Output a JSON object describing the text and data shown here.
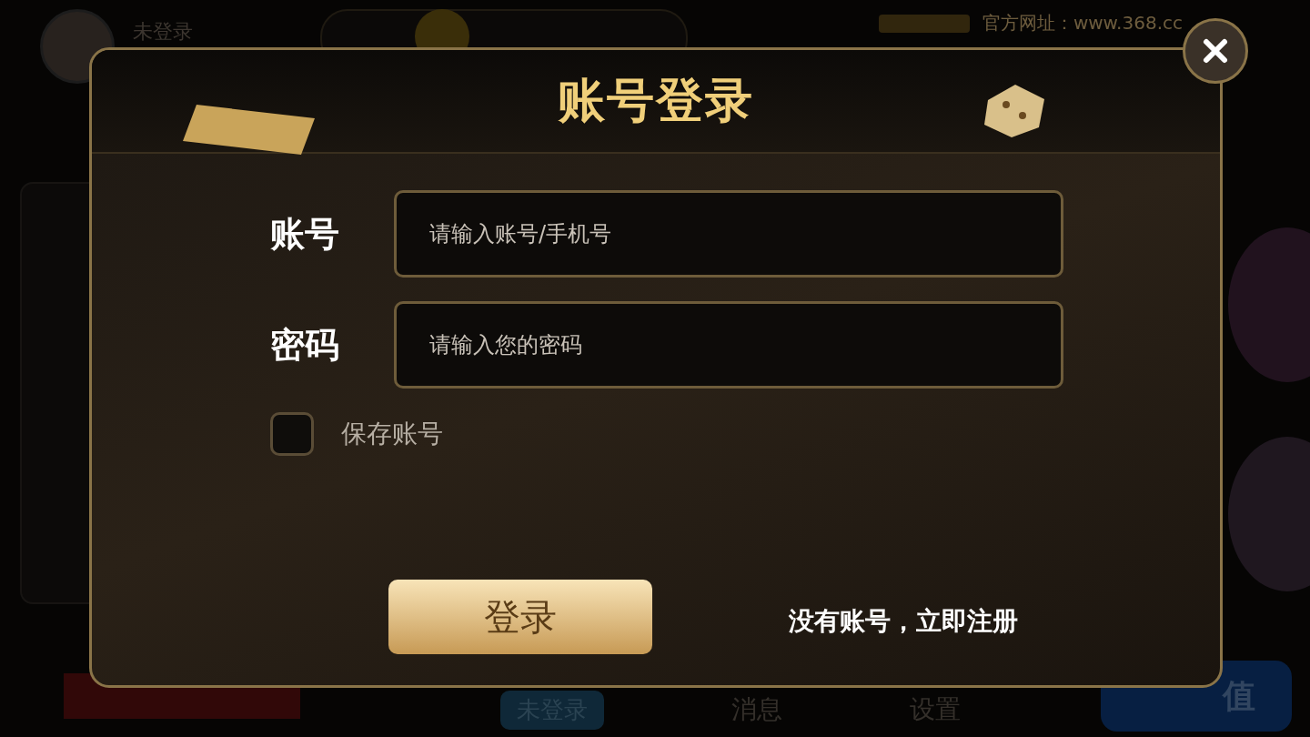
{
  "background": {
    "user": {
      "name": "未登录"
    },
    "site": {
      "url_text": "官方网址：www.368.cc"
    },
    "bottom_bar": {
      "items": [
        {
          "label": "未登录",
          "kind": "badge"
        },
        {
          "label": "消息",
          "kind": "text"
        },
        {
          "label": "设置",
          "kind": "text"
        }
      ],
      "recharge": "值"
    }
  },
  "dialog": {
    "title": "账号登录",
    "fields": [
      {
        "label": "账号",
        "placeholder": "请输入账号/手机号"
      },
      {
        "label": "密码",
        "placeholder": "请输入您的密码"
      }
    ],
    "remember": {
      "label": "保存账号",
      "checked": false
    },
    "login_button": "登录",
    "register_link": "没有账号，立即注册"
  }
}
